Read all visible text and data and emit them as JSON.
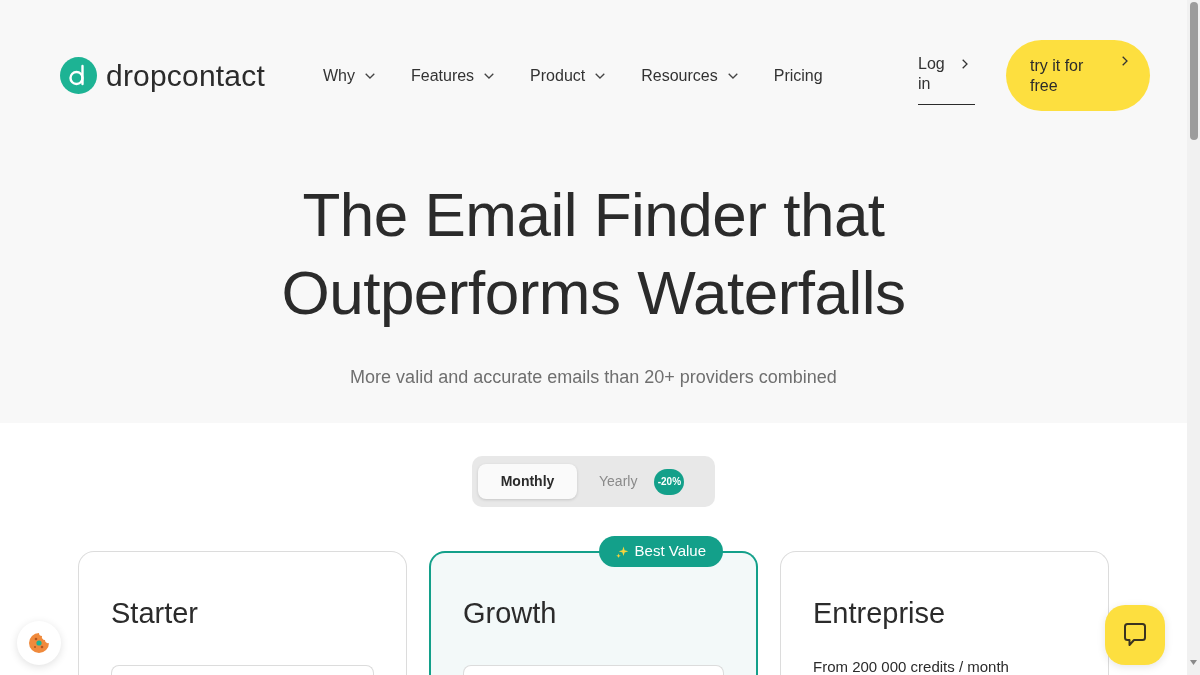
{
  "header": {
    "logo": {
      "text": "dropcontact"
    },
    "nav_items": [
      {
        "label": "Why",
        "dropdown": true
      },
      {
        "label": "Features",
        "dropdown": true
      },
      {
        "label": "Product",
        "dropdown": true
      },
      {
        "label": "Resources",
        "dropdown": true
      },
      {
        "label": "Pricing",
        "dropdown": false
      }
    ],
    "login": {
      "label": "Log in"
    },
    "cta": {
      "label": "try it for free"
    }
  },
  "hero": {
    "title": "The Email Finder that Outperforms Waterfalls",
    "subtitle": "More valid and accurate emails than 20+ providers combined"
  },
  "billing_toggle": {
    "options": [
      {
        "label": "Monthly",
        "selected": true
      },
      {
        "label": "Yearly",
        "selected": false,
        "badge": "-20%"
      }
    ]
  },
  "plans": [
    {
      "name": "Starter",
      "featured": false,
      "kind": "select"
    },
    {
      "name": "Growth",
      "featured": true,
      "ribbon": "Best Value",
      "kind": "select"
    },
    {
      "name": "Entreprise",
      "featured": false,
      "kind": "note",
      "note": "From 200 000 credits / month"
    }
  ]
}
